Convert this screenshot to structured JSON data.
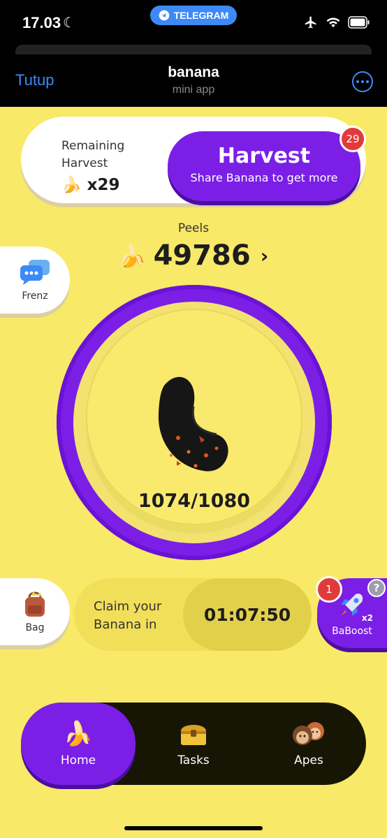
{
  "status_bar": {
    "time": "17.03",
    "telegram_label": "TELEGRAM"
  },
  "header": {
    "close_label": "Tutup",
    "title": "banana",
    "subtitle": "mini app"
  },
  "harvest": {
    "remaining_label_line1": "Remaining",
    "remaining_label_line2": "Harvest",
    "remaining_count": "x29",
    "button_title": "Harvest",
    "button_subtitle": "Share Banana to get more",
    "badge_count": "29"
  },
  "peels": {
    "label": "Peels",
    "value": "49786"
  },
  "energy": {
    "value": "1074/1080"
  },
  "side": {
    "frenz_label": "Frenz",
    "bag_label": "Bag",
    "baboost_label": "BaBoost",
    "baboost_badge": "1",
    "baboost_multiplier": "x2",
    "help": "?"
  },
  "claim": {
    "line1": "Claim your",
    "line2": "Banana in",
    "timer": "01:07:50"
  },
  "nav": {
    "home": "Home",
    "tasks": "Tasks",
    "apes": "Apes"
  },
  "colors": {
    "accent_purple": "#7b1fe7",
    "background_yellow": "#f9e968",
    "telegram_blue": "#3d8af7",
    "badge_red": "#e23a3a"
  }
}
